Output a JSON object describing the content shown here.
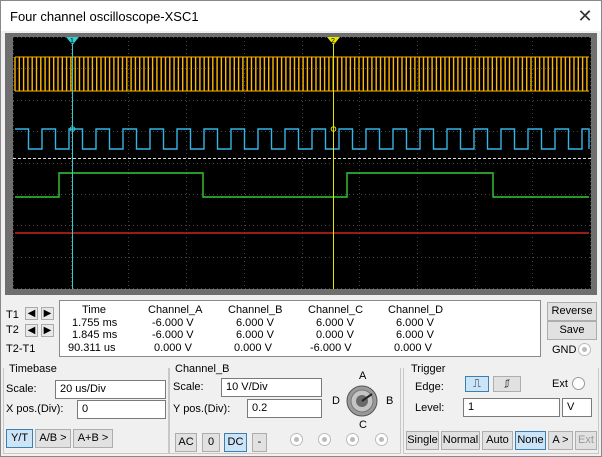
{
  "window": {
    "title": "Four channel oscilloscope-XSC1",
    "close_icon": "close-icon"
  },
  "readout": {
    "headers": [
      "Time",
      "Channel_A",
      "Channel_B",
      "Channel_C",
      "Channel_D"
    ],
    "rows": [
      {
        "label": "T1",
        "values": [
          "1.755 ms",
          "-6.000 V",
          "6.000 V",
          "6.000 V",
          "6.000 V"
        ]
      },
      {
        "label": "T2",
        "values": [
          "1.845 ms",
          "-6.000 V",
          "6.000 V",
          "0.000 V",
          "6.000 V"
        ]
      },
      {
        "label": "T2-T1",
        "values": [
          "90.311 us",
          "0.000 V",
          "0.000 V",
          "-6.000 V",
          "0.000 V"
        ]
      }
    ]
  },
  "side_buttons": {
    "reverse": "Reverse",
    "save": "Save",
    "gnd": "GND"
  },
  "timebase": {
    "title": "Timebase",
    "scale_label": "Scale:",
    "scale_value": "20 us/Div",
    "xpos_label": "X pos.(Div):",
    "xpos_value": "0",
    "modes": [
      "Y/T",
      "A/B >",
      "A+B >"
    ],
    "active_mode": "Y/T"
  },
  "channel": {
    "title": "Channel_B",
    "scale_label": "Scale:",
    "scale_value": "10  V/Div",
    "ypos_label": "Y pos.(Div):",
    "ypos_value": "0.2",
    "coupling": [
      "AC",
      "0",
      "DC",
      "-"
    ],
    "active_coupling": "DC",
    "knob_labels": {
      "a": "A",
      "b": "B",
      "c": "C",
      "d": "D"
    }
  },
  "trigger": {
    "title": "Trigger",
    "edge_label": "Edge:",
    "edge_rising": "rising-edge-icon",
    "edge_falling": "falling-edge-icon",
    "ext_label": "Ext",
    "level_label": "Level:",
    "level_value": "1",
    "level_unit": "V",
    "modes": [
      "Single",
      "Normal",
      "Auto",
      "None",
      "A >",
      "Ext"
    ],
    "active_mode": "None"
  },
  "cursors": {
    "t1": "1",
    "t2": "2"
  },
  "colors": {
    "channel_a": "#ffb600",
    "channel_b": "#33b5e5",
    "channel_c": "#33cc33",
    "channel_d": "#cc2222",
    "cursor_t1": "#33cccc",
    "cursor_t2": "#e6e600"
  }
}
